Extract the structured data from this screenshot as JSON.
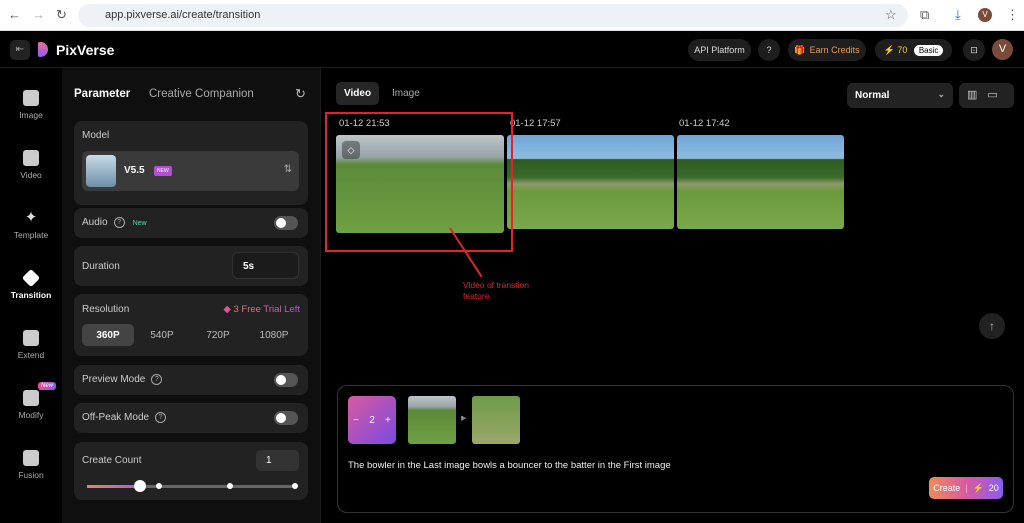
{
  "browser": {
    "url": "app.pixverse.ai/create/transition",
    "avatar": "V"
  },
  "header": {
    "brand": "PixVerse",
    "api": "API Platform",
    "earn": "Earn Credits",
    "credits": "70",
    "plan": "Basic",
    "avatar": "V"
  },
  "leftnav": [
    {
      "label": "Image"
    },
    {
      "label": "Video"
    },
    {
      "label": "Template"
    },
    {
      "label": "Transition",
      "active": true
    },
    {
      "label": "Extend"
    },
    {
      "label": "Modify",
      "badge": "New"
    },
    {
      "label": "Fusion"
    }
  ],
  "panel": {
    "tabs": [
      "Parameter",
      "Creative Companion"
    ],
    "model": {
      "label": "Model",
      "name": "V5.5",
      "badge": "NEW"
    },
    "audio": {
      "label": "Audio",
      "badge": "New",
      "on": false
    },
    "duration": {
      "label": "Duration",
      "value": "5s"
    },
    "resolution": {
      "label": "Resolution",
      "trial": "3 Free Trial Left",
      "options": [
        "360P",
        "540P",
        "720P",
        "1080P"
      ],
      "selected": "360P"
    },
    "preview": {
      "label": "Preview Mode",
      "on": false
    },
    "offpeak": {
      "label": "Off-Peak Mode",
      "on": false
    },
    "count": {
      "label": "Create Count",
      "value": "1",
      "slider_fraction": 0.25
    }
  },
  "main": {
    "tabs": [
      "Video",
      "Image"
    ],
    "quality": "Normal",
    "videos": [
      {
        "time": "01-12 21:53"
      },
      {
        "time": "01-12 17:57"
      },
      {
        "time": "01-12 17:42"
      }
    ],
    "annotation": "Video of transtion feature",
    "prompt": {
      "count": "2",
      "text": "The bowler in the Last image bowls a bouncer to the batter in the First image",
      "create": "Create",
      "cost": "20"
    }
  },
  "colors": {
    "accent": "#e8508f",
    "annotation": "#e0242b"
  }
}
